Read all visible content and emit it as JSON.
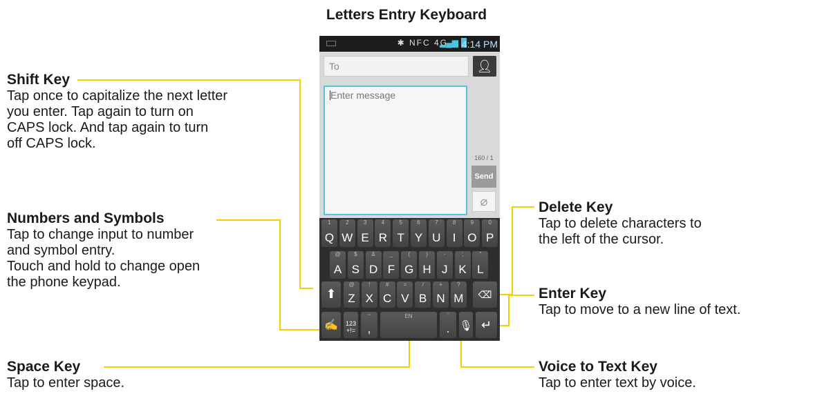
{
  "title": "Letters Entry Keyboard",
  "callouts": {
    "shift": {
      "heading": "Shift Key",
      "desc": "Tap once to capitalize the next letter\nyou enter. Tap again to turn on\nCAPS lock. And tap again to turn\noff CAPS lock."
    },
    "numbers": {
      "heading": "Numbers and Symbols",
      "desc": "Tap to change input to number\nand symbol entry.\nTouch and hold to change open\nthe phone keypad."
    },
    "space": {
      "heading": "Space Key",
      "desc": "Tap to enter space."
    },
    "delete": {
      "heading": "Delete Key",
      "desc": "Tap to delete characters to\nthe left of the cursor."
    },
    "enter": {
      "heading": "Enter Key",
      "desc": "Tap to move to a new line of text."
    },
    "voice": {
      "heading": "Voice to Text Key",
      "desc": "Tap to enter text by voice."
    }
  },
  "phone": {
    "status_time": "4:14 PM",
    "status_icons": "✱ NFC 4G",
    "to_placeholder": "To",
    "message_placeholder": "Enter message",
    "counter": "160 / 1",
    "send_label": "Send",
    "keyboard": {
      "row1": [
        [
          "Q",
          "1"
        ],
        [
          "W",
          "2"
        ],
        [
          "E",
          "3"
        ],
        [
          "R",
          "4"
        ],
        [
          "T",
          "5"
        ],
        [
          "Y",
          "6"
        ],
        [
          "U",
          "7"
        ],
        [
          "I",
          "8"
        ],
        [
          "O",
          "9"
        ],
        [
          "P",
          "0"
        ]
      ],
      "row2": [
        [
          "A",
          "@"
        ],
        [
          "S",
          "$"
        ],
        [
          "D",
          "&"
        ],
        [
          "F",
          "_"
        ],
        [
          "G",
          "("
        ],
        [
          "H",
          ")"
        ],
        [
          "J",
          "-"
        ],
        [
          "K",
          ";"
        ],
        [
          "L",
          "\""
        ]
      ],
      "row3": [
        [
          "Z",
          "@"
        ],
        [
          "X",
          "!"
        ],
        [
          "C",
          "#"
        ],
        [
          "V",
          "="
        ],
        [
          "B",
          "/"
        ],
        [
          "N",
          "+"
        ],
        [
          "M",
          "?"
        ]
      ],
      "sym_key": "123\n+!=",
      "comma_key": ",",
      "space_label": "EN",
      "period_key": "."
    }
  },
  "colors": {
    "callout_line": "#f5d000",
    "field_focus": "#4fc3e0",
    "keyboard_bg": "#2e2e2e"
  }
}
